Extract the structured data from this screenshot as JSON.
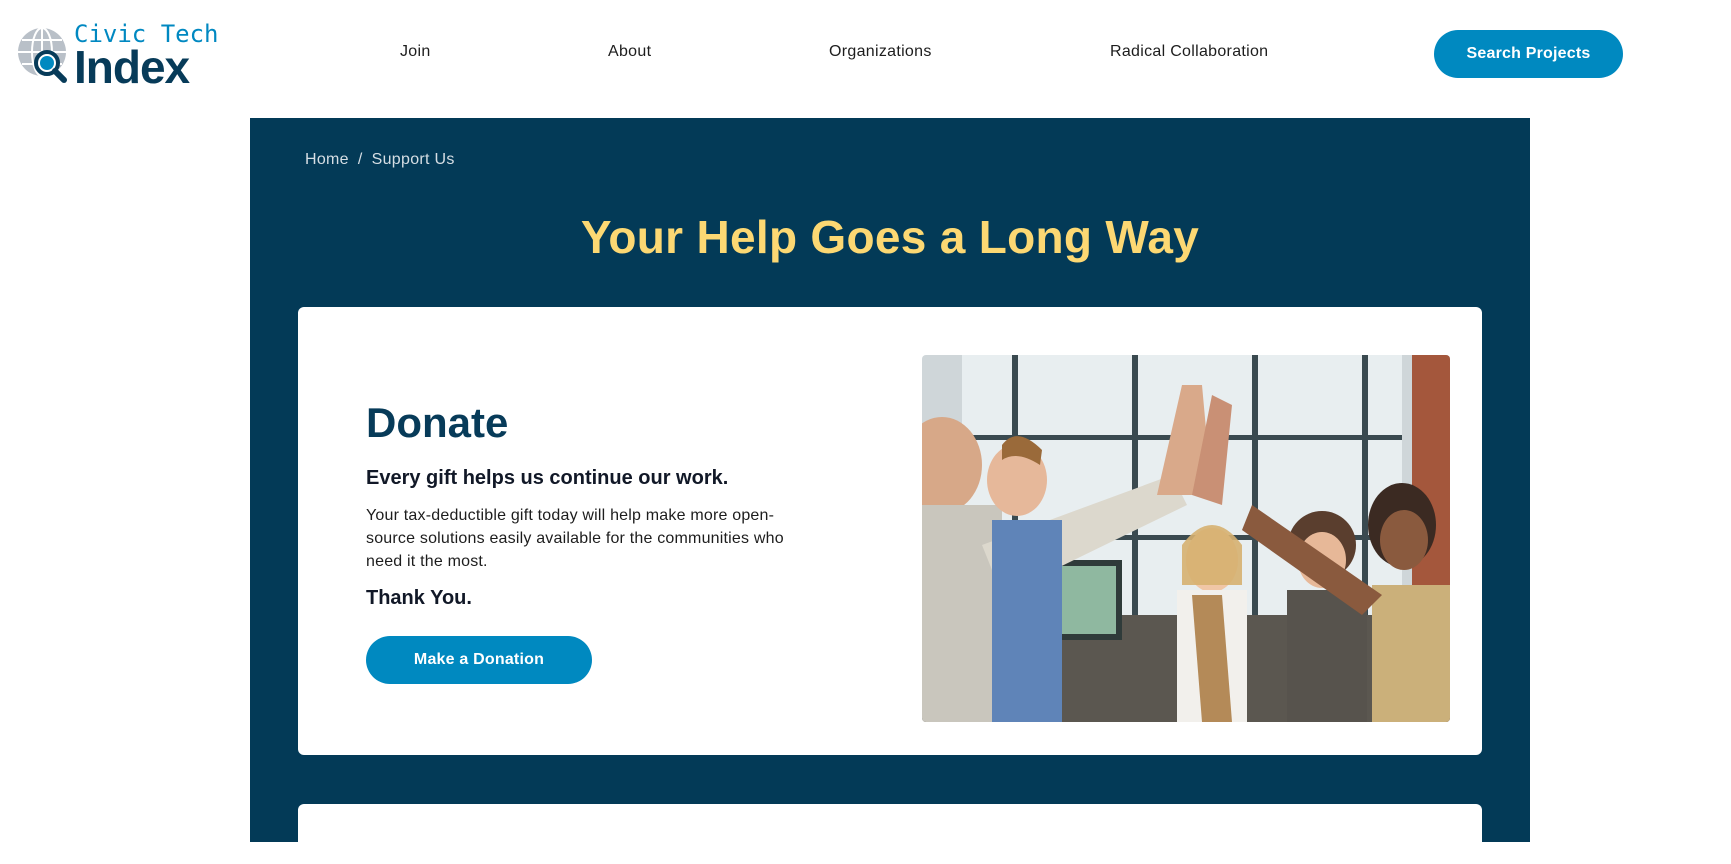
{
  "brand": {
    "line1": "Civic Tech",
    "line2": "Index",
    "icon": "globe-magnifier-icon"
  },
  "nav": {
    "items": [
      {
        "label": "Join"
      },
      {
        "label": "About"
      },
      {
        "label": "Organizations"
      },
      {
        "label": "Radical Collaboration"
      }
    ],
    "cta_label": "Search Projects"
  },
  "breadcrumb": {
    "items": [
      "Home",
      "Support Us"
    ],
    "separator": "/"
  },
  "hero": {
    "title": "Your Help Goes a Long Way"
  },
  "donate": {
    "heading": "Donate",
    "subheading": "Every gift helps us continue our work.",
    "body": "Your tax-deductible gift today will help make more open-source solutions easily available for the communities who need it the most.",
    "thanks": "Thank You.",
    "button_label": "Make a Donation",
    "image": "photo-team-high-five"
  },
  "colors": {
    "navy": "#033a57",
    "accent_blue": "#0089c0",
    "title_yellow": "#fcd873",
    "heading_navy": "#073b59"
  }
}
